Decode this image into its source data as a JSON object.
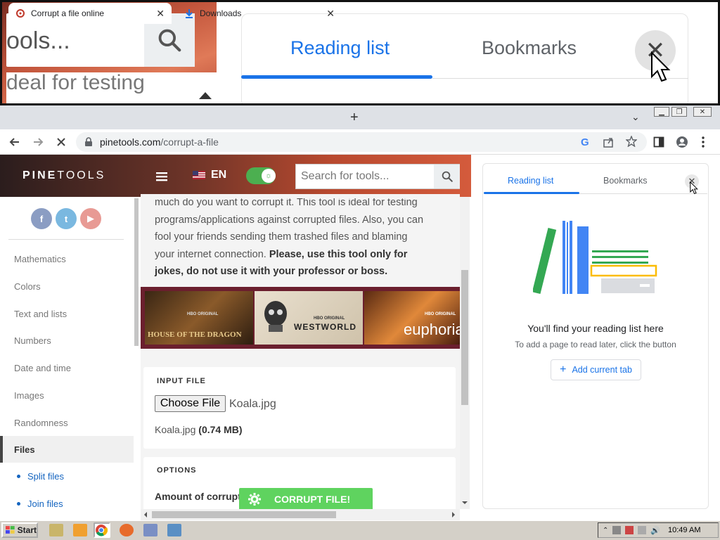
{
  "magnifier": {
    "search_text": "ools...",
    "strip_text": "deal for testing",
    "reading_list": "Reading list",
    "bookmarks": "Bookmarks",
    "close_glyph": "✕"
  },
  "browser": {
    "tabs": [
      {
        "title": "Corrupt a file online",
        "icon": "pinetools-favicon",
        "close": "✕"
      },
      {
        "title": "Downloads",
        "icon": "download-icon",
        "close": "✕"
      }
    ],
    "new_tab": "+",
    "tab_dropdown": "⌄",
    "url_host": "pinetools.com",
    "url_path": "/corrupt-a-file"
  },
  "site": {
    "logo_bold": "PINE",
    "logo_thin": "TOOLS",
    "lang": "EN",
    "search_placeholder": "Search for tools...",
    "social": [
      "f",
      "t",
      "▶"
    ],
    "nav": [
      "Mathematics",
      "Colors",
      "Text and lists",
      "Numbers",
      "Date and time",
      "Images",
      "Randomness",
      "Files"
    ],
    "subnav": [
      "Split files",
      "Join files"
    ],
    "intro_lines": [
      "much do you want to corrupt it. This tool is ideal for testing",
      "programs/applications against corrupted files. Also, you can",
      "fool your friends sending them trashed files and blaming",
      "your internet connection."
    ],
    "intro_bold_a": "Please, use this tool only for",
    "intro_bold_b": "jokes, do not use it with your professor or boss.",
    "banner": {
      "hbo1": "HBO ORIGINAL",
      "hbo2": "HBO ORIGINAL",
      "hbo3": "HBO ORIGINAL",
      "show1": "HOUSE OF THE DRAGON",
      "show2": "WESTWORLD",
      "show3": "euphoria"
    },
    "input_file_label": "INPUT FILE",
    "choose_file": "Choose File",
    "file_chosen": "Koala.jpg",
    "file_name": "Koala.jpg",
    "file_size": "(0.74 MB)",
    "options_label": "OPTIONS",
    "amount_label": "Amount of corrupt",
    "corrupt_button": "CORRUPT FILE!"
  },
  "side_panel": {
    "tab_reading": "Reading list",
    "tab_bookmarks": "Bookmarks",
    "close": "✕",
    "empty_title": "You'll find your reading list here",
    "empty_sub": "To add a page to read later, click the button",
    "add_button": "Add current tab"
  },
  "taskbar": {
    "start": "Start",
    "clock": "10:49 AM"
  },
  "colors": {
    "accent_blue": "#1a73e8",
    "corrupt_green": "#5fd35f",
    "toggle_green": "#4caf50"
  }
}
